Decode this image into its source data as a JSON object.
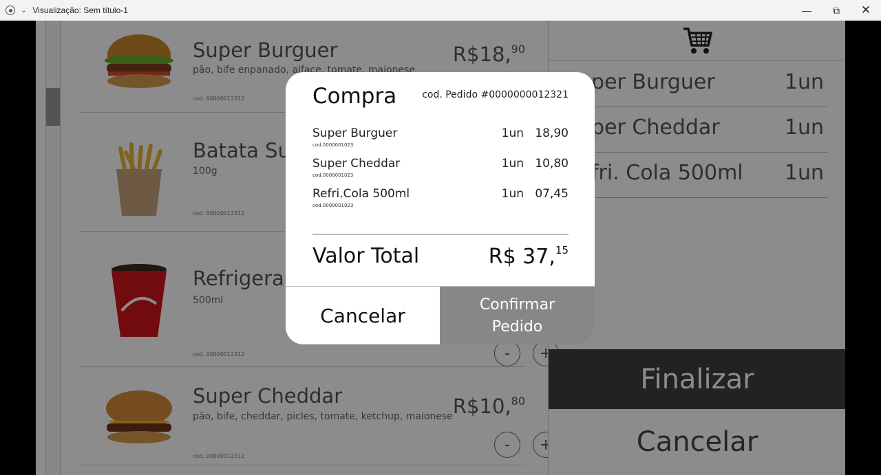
{
  "window": {
    "title": "Visualização: Sem título-1"
  },
  "menu": {
    "items": [
      {
        "name": "Super Burguer",
        "desc": "pão, bife enpanado, alface, tomate, maionese",
        "cod": "cod. 00000012312",
        "price_int": "R$18,",
        "price_cents": "90"
      },
      {
        "name": "Batata Supreme",
        "desc": "100g",
        "cod": "cod. 00000012312"
      },
      {
        "name": "Refrigerante Cola",
        "desc": "500ml",
        "cod": "cod. 00000012312"
      },
      {
        "name": "Super Cheddar",
        "desc": "pão, bife, cheddar, picles, tomate, ketchup, maionese",
        "cod": "cod. 00000012312",
        "price_int": "R$10,",
        "price_cents": "80"
      }
    ],
    "minus": "-",
    "plus": "+"
  },
  "cart": {
    "items": [
      {
        "name": "Super Burguer",
        "qty": "1un"
      },
      {
        "name": "Super Cheddar",
        "qty": "1un"
      },
      {
        "name": "Refri. Cola 500ml",
        "qty": "1un"
      }
    ],
    "finalizar": "Finalizar",
    "cancelar": "Cancelar"
  },
  "modal": {
    "title": "Compra",
    "cod_pedido": "cod. Pedido  #0000000012321",
    "items": [
      {
        "name": "Super Burguer",
        "cod": "cod.0000001023",
        "qty": "1un",
        "price": "18,90"
      },
      {
        "name": "Super Cheddar",
        "cod": "cod.0000001023",
        "qty": "1un",
        "price": "10,80"
      },
      {
        "name": "Refri.Cola 500ml",
        "cod": "cod.0000001023",
        "qty": "1un",
        "price": "07,45"
      }
    ],
    "total_label": "Valor Total",
    "total_int": "R$ 37,",
    "total_cents": "15",
    "cancel": "Cancelar",
    "confirm": "Confirmar\nPedido"
  }
}
